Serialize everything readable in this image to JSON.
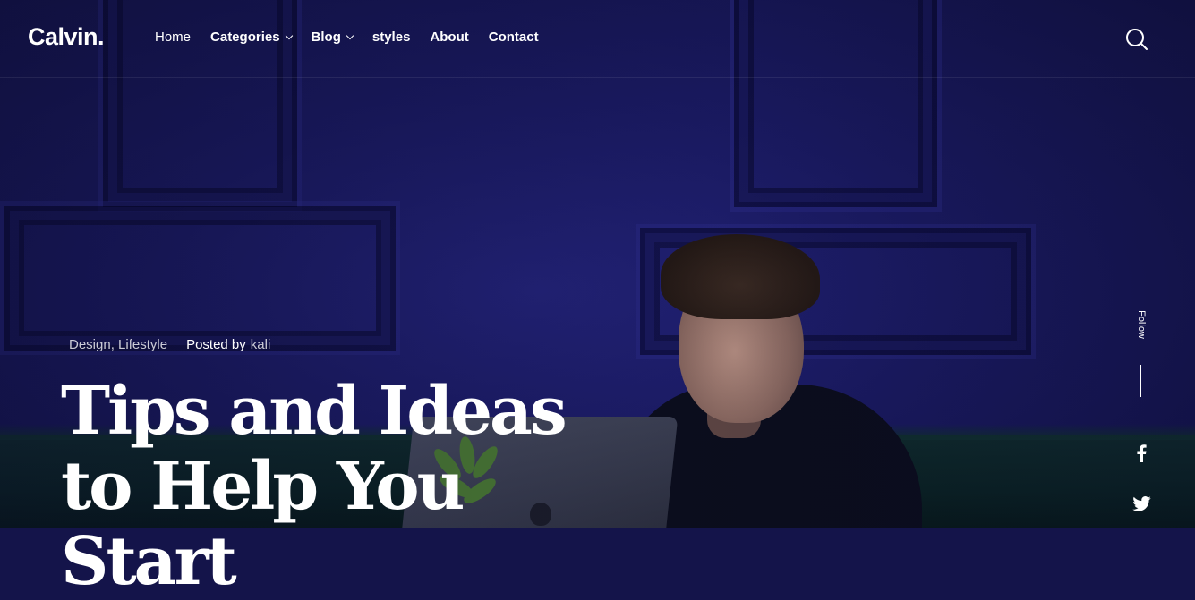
{
  "brand": {
    "logo": "Calvin."
  },
  "nav": {
    "items": [
      {
        "label": "Home",
        "has_dropdown": false
      },
      {
        "label": "Categories",
        "has_dropdown": true
      },
      {
        "label": "Blog",
        "has_dropdown": true
      },
      {
        "label": "styles",
        "has_dropdown": false
      },
      {
        "label": "About",
        "has_dropdown": false
      },
      {
        "label": "Contact",
        "has_dropdown": false
      }
    ],
    "search_icon": "search-icon"
  },
  "hero": {
    "categories": "Design, Lifestyle",
    "posted_by_label": "Posted by",
    "author": "kali",
    "title": "Tips and Ideas to Help You Start"
  },
  "follow": {
    "label": "Follow",
    "socials": [
      {
        "icon": "facebook-icon"
      },
      {
        "icon": "twitter-icon"
      }
    ]
  },
  "colors": {
    "background": "#14144a",
    "text": "#ffffff"
  }
}
